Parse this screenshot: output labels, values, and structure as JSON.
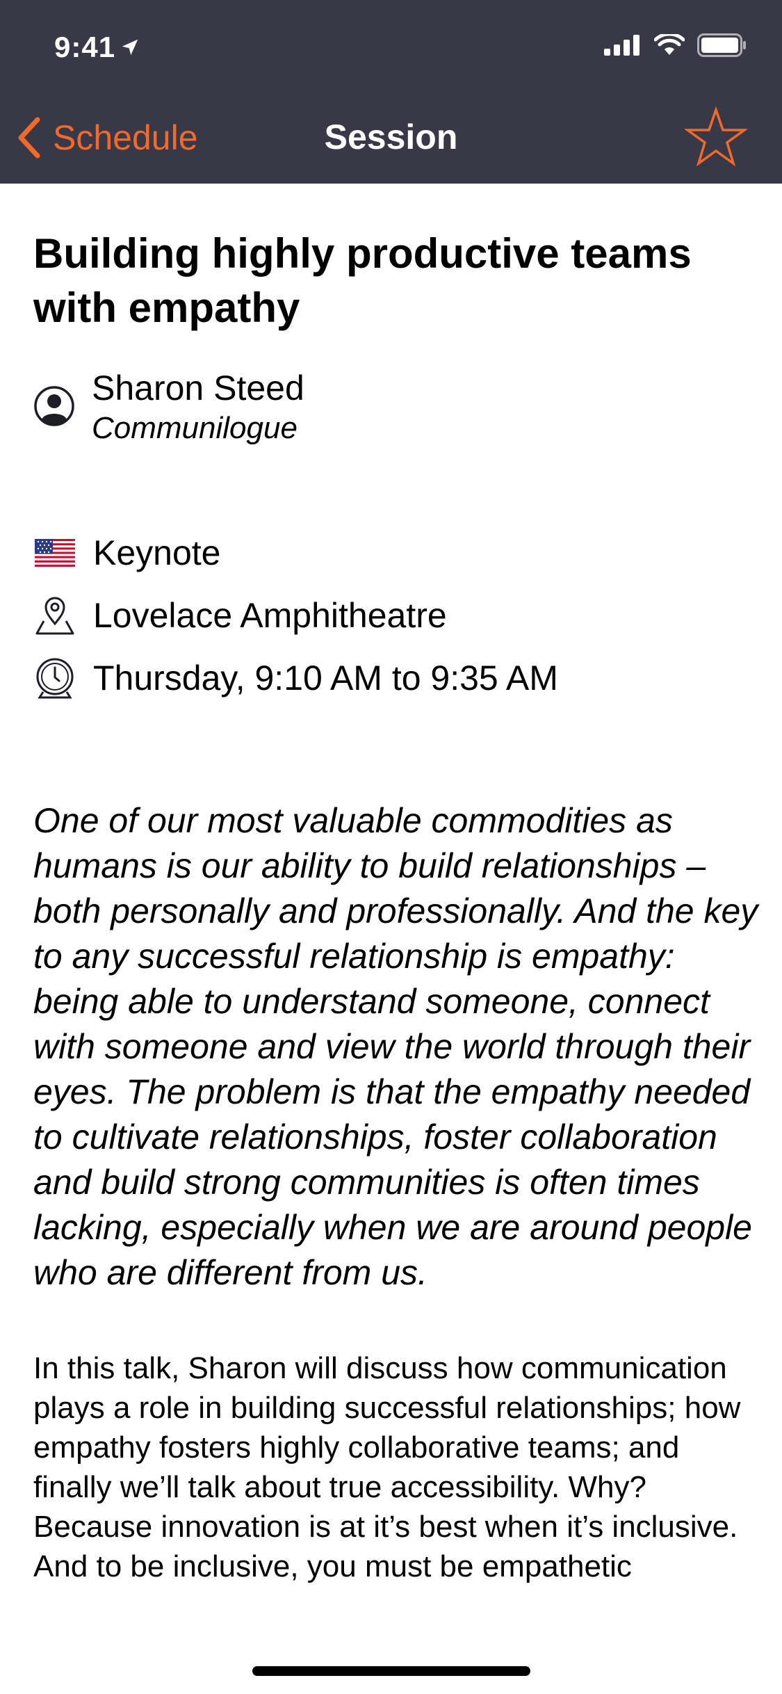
{
  "status_bar": {
    "time": "9:41"
  },
  "nav": {
    "back_label": "Schedule",
    "title": "Session"
  },
  "session": {
    "title": "Building highly productive teams with empathy",
    "speaker": {
      "name": "Sharon Steed",
      "company": "Communilogue"
    },
    "track": "Keynote",
    "room": "Lovelace Amphitheatre",
    "time": "Thursday, 9:10 AM to 9:35 AM",
    "abstract": "One of our most valuable commodities as humans is our ability to build relationships – both personally and professionally. And the key to any successful relationship is empathy: being able to understand someone, connect with someone and view the world through their eyes. The problem is that the empathy needed to cultivate relationships, foster collaboration and build strong communities is often times lacking, especially when we are around people who are different from us.",
    "description": "In this talk, Sharon will discuss how communication plays a role in building successful relationships; how empathy fosters highly collaborative teams; and finally we’ll talk about true accessibility. Why? Because innovation is at it’s best when it’s inclusive. And to be inclusive, you must be empathetic"
  },
  "colors": {
    "header_bg": "#393846",
    "accent": "#ef6a2c",
    "text": "#000000"
  },
  "icons": {
    "location_arrow": "location-arrow-icon",
    "signal": "cellular-signal-icon",
    "wifi": "wifi-icon",
    "battery": "battery-icon",
    "back": "chevron-left-icon",
    "favorite": "star-outline-icon",
    "speaker": "person-circle-icon",
    "track": "us-flag-icon",
    "room": "map-pin-icon",
    "time": "clock-icon"
  }
}
